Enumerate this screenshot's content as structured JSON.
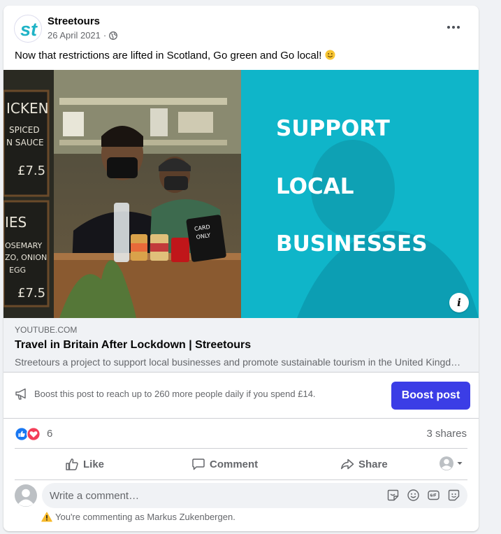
{
  "post": {
    "page_name": "Streetours",
    "date": "26 April 2021",
    "date_separator": "·",
    "text": "Now that restrictions are lifted in Scotland, Go green and Go local!",
    "avatar_text": "st"
  },
  "media": {
    "overlay_lines": [
      "SUPPORT",
      "LOCAL",
      "BUSINESSES"
    ],
    "chalkboard_top": [
      "ICKEN",
      "SPICED",
      "N SAUCE",
      "£7.5"
    ],
    "chalkboard_bottom": [
      "IES",
      "OSEMARY",
      "ZO, ONION",
      "EGG",
      "£7.5"
    ],
    "card_sign": [
      "CARD",
      "ONLY"
    ],
    "info_label": "i",
    "overlay_color": "#00b4c8"
  },
  "link": {
    "domain": "YOUTUBE.COM",
    "title": "Travel in Britain After Lockdown | Streetours",
    "description": "Streetours a project to support local businesses and promote sustainable tourism in the United Kingdom"
  },
  "boost": {
    "text": "Boost this post to reach up to 260 more people daily if you spend £14.",
    "button": "Boost post",
    "button_color": "#3b3de6"
  },
  "stats": {
    "reaction_count": "6",
    "shares": "3 shares"
  },
  "actions": {
    "like": "Like",
    "comment": "Comment",
    "share": "Share"
  },
  "comment": {
    "placeholder": "Write a comment…",
    "notice": "You're commenting as Markus Zukenbergen."
  },
  "icons": [
    "more-icon",
    "globe-icon",
    "info-icon",
    "megaphone-icon",
    "like-reaction-icon",
    "love-reaction-icon",
    "like-icon",
    "comment-icon",
    "share-icon",
    "audience-avatar-icon",
    "chevron-down-icon",
    "sticker-icon",
    "emoji-icon",
    "gif-icon",
    "avatar-sticker-icon",
    "warning-icon"
  ]
}
